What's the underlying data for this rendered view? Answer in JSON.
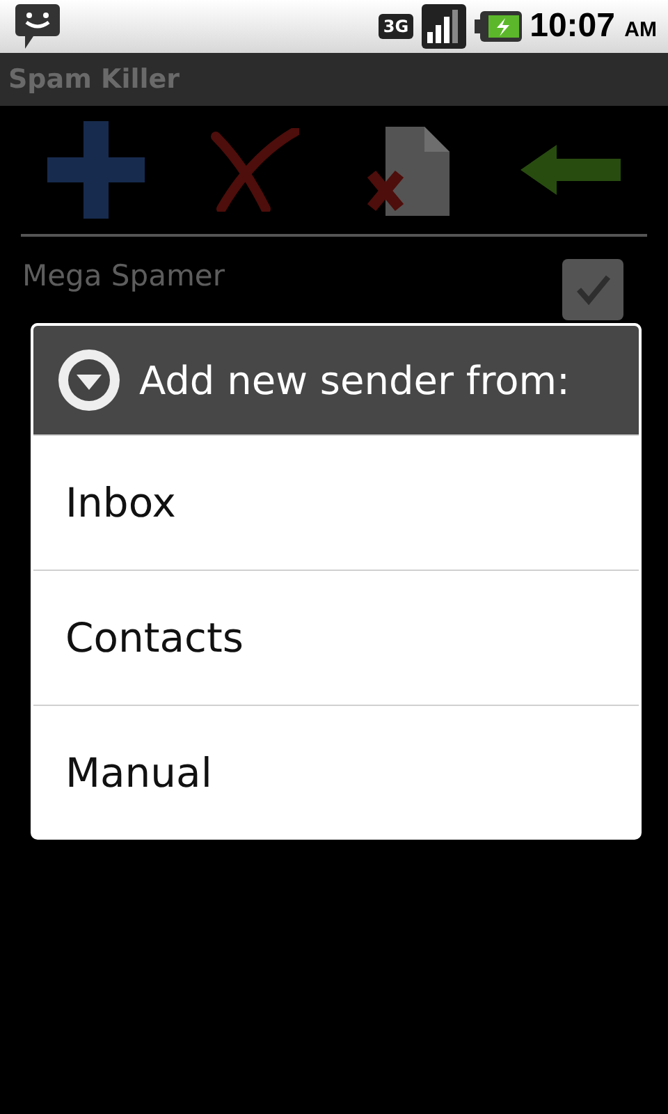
{
  "status_bar": {
    "network": "3G",
    "time": "10:07",
    "meridiem": "AM"
  },
  "title_bar": {
    "title": "Spam Killer"
  },
  "list": [
    {
      "name": "Mega Spamer",
      "checked": true
    }
  ],
  "dialog": {
    "title": "Add new sender from:",
    "options": [
      "Inbox",
      "Contacts",
      "Manual"
    ]
  }
}
